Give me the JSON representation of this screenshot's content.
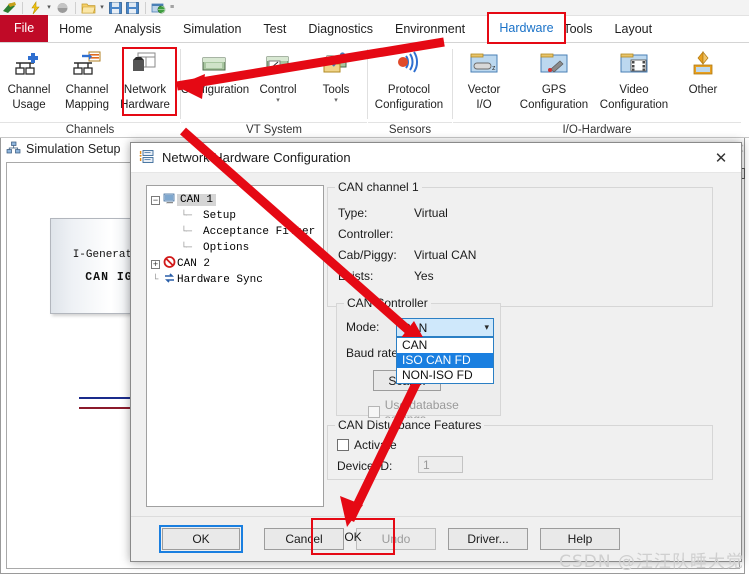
{
  "quick_access": {
    "icons": [
      "vector-logo-icon",
      "lightning-icon",
      "dropdown-caret-icon",
      "grey-circle-icon",
      "open-folder-icon",
      "dropdown-caret-icon",
      "save-icon",
      "save-as-icon",
      "globe-window-icon",
      "overflow-caret-icon"
    ]
  },
  "ribbon": {
    "tabs": [
      {
        "label": "File",
        "state": "file"
      },
      {
        "label": "Home",
        "state": "normal"
      },
      {
        "label": "Analysis",
        "state": "normal"
      },
      {
        "label": "Simulation",
        "state": "normal"
      },
      {
        "label": "Test",
        "state": "normal"
      },
      {
        "label": "Diagnostics",
        "state": "normal"
      },
      {
        "label": "Environment",
        "state": "normal"
      },
      {
        "label": "Hardware",
        "state": "active"
      },
      {
        "label": "Tools",
        "state": "normal"
      },
      {
        "label": "Layout",
        "state": "normal"
      }
    ],
    "groups": [
      {
        "label": "Channels",
        "items": [
          {
            "line1": "Channel",
            "line2": "Usage",
            "icon": "channel-usage-icon",
            "dropdown": false
          },
          {
            "line1": "Channel",
            "line2": "Mapping",
            "icon": "channel-mapping-icon",
            "dropdown": false
          },
          {
            "line1": "Network",
            "line2": "Hardware",
            "icon": "network-hardware-icon",
            "dropdown": false
          }
        ]
      },
      {
        "label": "VT System",
        "items": [
          {
            "line1": "Configuration",
            "line2": "",
            "icon": "vt-configuration-icon",
            "dropdown": false
          },
          {
            "line1": "Control",
            "line2": "",
            "icon": "vt-control-icon",
            "dropdown": true
          },
          {
            "line1": "Tools",
            "line2": "",
            "icon": "vt-tools-icon",
            "dropdown": true
          }
        ]
      },
      {
        "label": "Sensors",
        "items": [
          {
            "line1": "Protocol",
            "line2": "Configuration",
            "icon": "protocol-configuration-icon",
            "dropdown": false
          }
        ]
      },
      {
        "label": "I/O-Hardware",
        "items": [
          {
            "line1": "Vector",
            "line2": "I/O",
            "icon": "vector-io-icon",
            "dropdown": false
          },
          {
            "line1": "GPS",
            "line2": "Configuration",
            "icon": "gps-configuration-icon",
            "dropdown": false
          },
          {
            "line1": "Video",
            "line2": "Configuration",
            "icon": "video-configuration-icon",
            "dropdown": false
          },
          {
            "line1": "Other",
            "line2": "",
            "icon": "other-io-icon",
            "dropdown": false
          }
        ]
      }
    ]
  },
  "simulation_window": {
    "title": "Simulation Setup",
    "icon": "simulation-setup-icon",
    "close_label": "✕",
    "node": {
      "line1": "I-Generator",
      "line2": "CAN IG"
    }
  },
  "dialog": {
    "title": "Network Hardware Configuration",
    "icon": "network-hardware-config-icon",
    "close_label": "✕",
    "tree": [
      {
        "label": "CAN 1",
        "expander": "−",
        "icon": "monitor-icon",
        "depth": 0,
        "selected": true
      },
      {
        "label": "Setup",
        "expander": "",
        "icon": "",
        "depth": 1,
        "selected": false
      },
      {
        "label": "Acceptance Filter",
        "expander": "",
        "icon": "",
        "depth": 1,
        "selected": false
      },
      {
        "label": "Options",
        "expander": "",
        "icon": "",
        "depth": 1,
        "selected": false
      },
      {
        "label": "CAN 2",
        "expander": "+",
        "icon": "no-entry-icon",
        "depth": 0,
        "selected": false
      },
      {
        "label": "Hardware Sync",
        "expander": "",
        "icon": "sync-icon",
        "depth": 0,
        "selected": false
      }
    ],
    "channel_group": {
      "label": "CAN channel 1",
      "fields": [
        {
          "name": "Type:",
          "value": "Virtual"
        },
        {
          "name": "Controller:",
          "value": ""
        },
        {
          "name": "Cab/Piggy:",
          "value": "Virtual CAN"
        },
        {
          "name": "Exists:",
          "value": "Yes"
        }
      ]
    },
    "controller_group": {
      "label": "CAN Controller",
      "mode_label": "Mode:",
      "mode_value": "CAN",
      "mode_options": [
        "CAN",
        "ISO CAN FD",
        "NON-ISO FD"
      ],
      "mode_selected_index": 1,
      "baud_label": "Baud rate:",
      "scan_button": "Scan...",
      "use_db_checkbox": "Use database settings",
      "use_db_checked": false,
      "use_db_enabled": false
    },
    "disturbance_group": {
      "label": "CAN Disturbance Features",
      "activate_checkbox": "Activate",
      "activate_checked": false,
      "device_id_label": "Device ID:",
      "device_id_value": "1"
    },
    "buttons": [
      {
        "label": "OK",
        "state": "focused"
      },
      {
        "label": "Cancel",
        "state": "normal"
      },
      {
        "label": "Undo",
        "state": "disabled"
      },
      {
        "label": "Driver...",
        "state": "normal"
      },
      {
        "label": "Help",
        "state": "normal"
      }
    ]
  },
  "annotations": {
    "highlight_boxes": [
      "network-hardware-button",
      "hardware-tab",
      "iso-can-fd-option",
      "ok-button"
    ],
    "arrow_color": "#e50914"
  },
  "watermark": "CSDN @汪汪队睡大觉"
}
